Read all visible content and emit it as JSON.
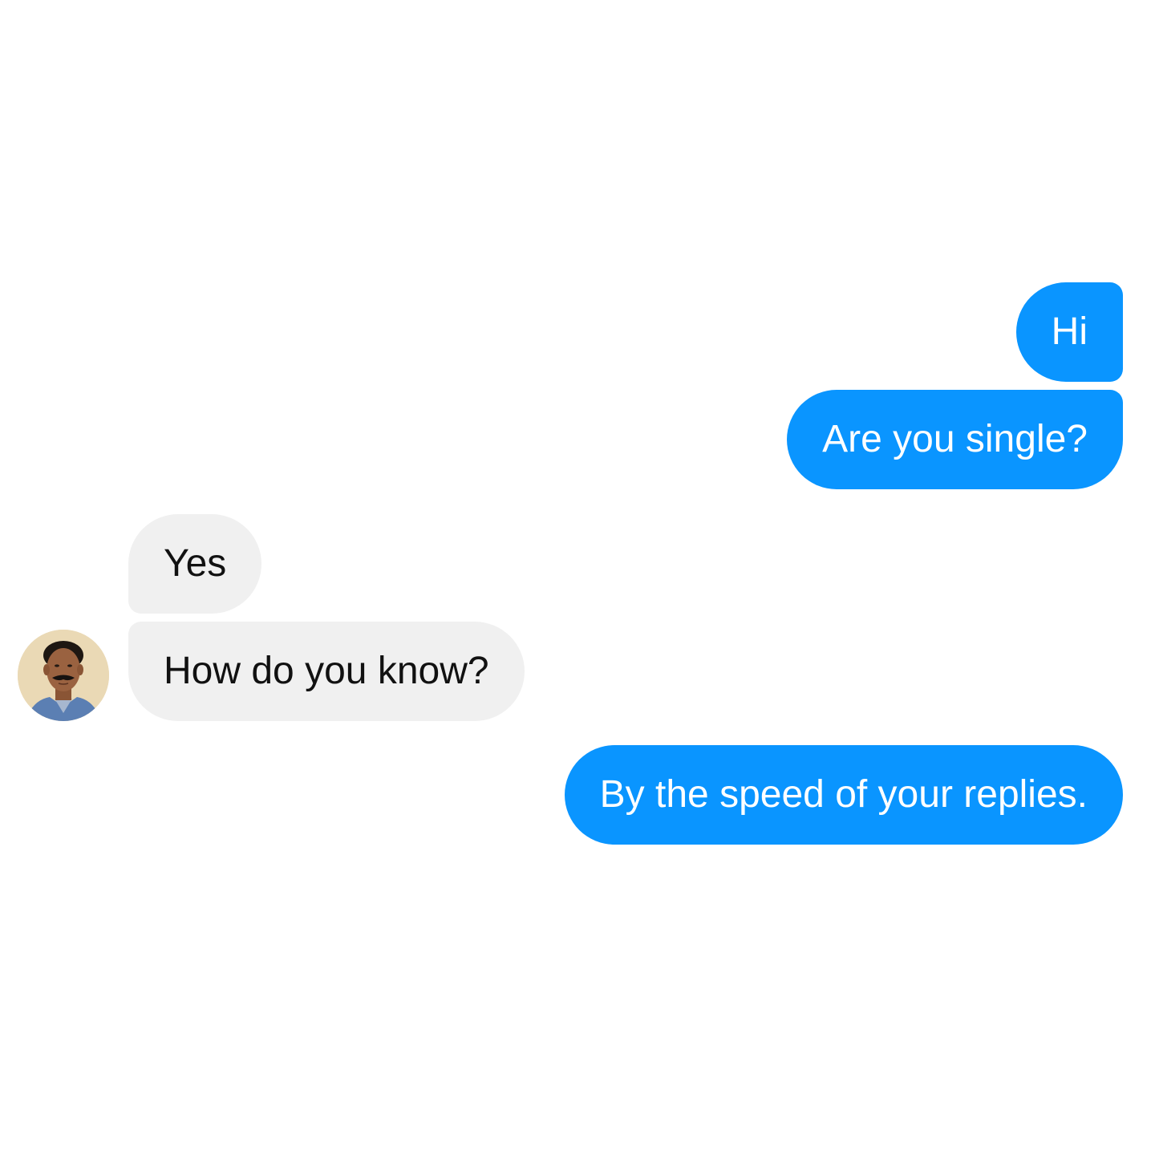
{
  "colors": {
    "sent_bubble": "#0a95ff",
    "received_bubble": "#f0f0f0",
    "sent_text": "#ffffff",
    "received_text": "#111111",
    "background": "#ffffff"
  },
  "contact": {
    "avatar_icon": "person-photo-avatar"
  },
  "messages": [
    {
      "direction": "sent",
      "text": "Hi"
    },
    {
      "direction": "sent",
      "text": "Are you single?"
    },
    {
      "direction": "received",
      "text": "Yes"
    },
    {
      "direction": "received",
      "text": "How do you know?"
    },
    {
      "direction": "sent",
      "text": "By the speed of your replies."
    }
  ]
}
